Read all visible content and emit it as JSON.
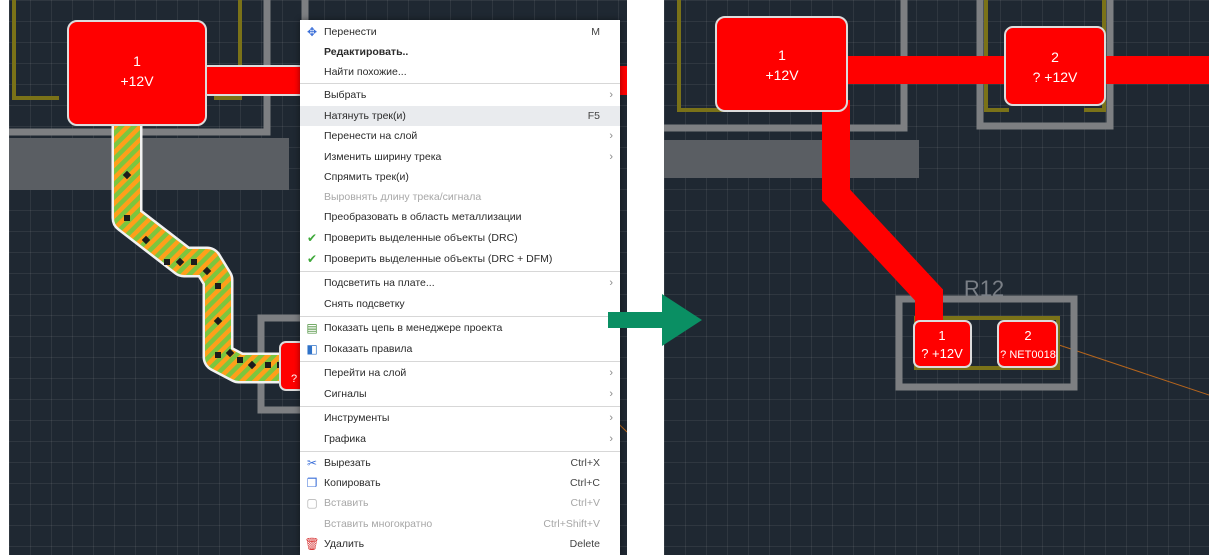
{
  "left_view": {
    "pad_1": {
      "number": "1",
      "net": "+12V"
    },
    "pad_2_partial": "?"
  },
  "context_menu": {
    "items": [
      {
        "label": "Перенести",
        "shortcut": "M",
        "icon": "move-icon"
      },
      {
        "label": "Редактировать..",
        "bold": true
      },
      {
        "label": "Найти похожие..."
      },
      {
        "label": "Выбрать",
        "submenu": true
      },
      {
        "label": "Натянуть трек(и)",
        "shortcut": "F5",
        "highlighted": true
      },
      {
        "label": "Перенести на слой",
        "submenu": true
      },
      {
        "label": "Изменить ширину трека",
        "submenu": true
      },
      {
        "label": "Спрямить трек(и)"
      },
      {
        "label": "Выровнять длину трека/сигнала",
        "disabled": true
      },
      {
        "label": "Преобразовать в область металлизации"
      },
      {
        "label": "Проверить выделенные объекты (DRC)",
        "icon": "check-icon"
      },
      {
        "label": "Проверить выделенные объекты (DRC + DFM)",
        "icon": "check-icon"
      },
      {
        "label": "Подсветить на плате...",
        "submenu": true
      },
      {
        "label": "Снять подсветку"
      },
      {
        "label": "Показать цепь в менеджере проекта",
        "icon": "net-manager-icon"
      },
      {
        "label": "Показать правила",
        "icon": "rules-icon"
      },
      {
        "label": "Перейти на слой",
        "submenu": true
      },
      {
        "label": "Сигналы",
        "submenu": true
      },
      {
        "label": "Инструменты",
        "submenu": true
      },
      {
        "label": "Графика",
        "submenu": true
      },
      {
        "label": "Вырезать",
        "shortcut": "Ctrl+X",
        "icon": "cut-icon"
      },
      {
        "label": "Копировать",
        "shortcut": "Ctrl+C",
        "icon": "copy-icon"
      },
      {
        "label": "Вставить",
        "shortcut": "Ctrl+V",
        "icon": "paste-icon",
        "disabled": true
      },
      {
        "label": "Вставить многократно",
        "shortcut": "Ctrl+Shift+V",
        "disabled": true
      },
      {
        "label": "Удалить",
        "shortcut": "Delete",
        "icon": "delete-icon"
      }
    ]
  },
  "right_view": {
    "pad_top_1": {
      "number": "1",
      "net": "+12V"
    },
    "pad_top_2": {
      "number": "2",
      "net": "? +12V"
    },
    "component_ref": "R12",
    "r12_pad_1": {
      "number": "1",
      "net": "? +12V"
    },
    "r12_pad_2": {
      "number": "2",
      "net": "? NET0018"
    }
  },
  "colors": {
    "board_background": "#1f2832",
    "copper": "#ff0000",
    "silkscreen": "#8e8e8e",
    "selection_hatch": "#7cc63e",
    "arrow": "#0a8f63"
  }
}
